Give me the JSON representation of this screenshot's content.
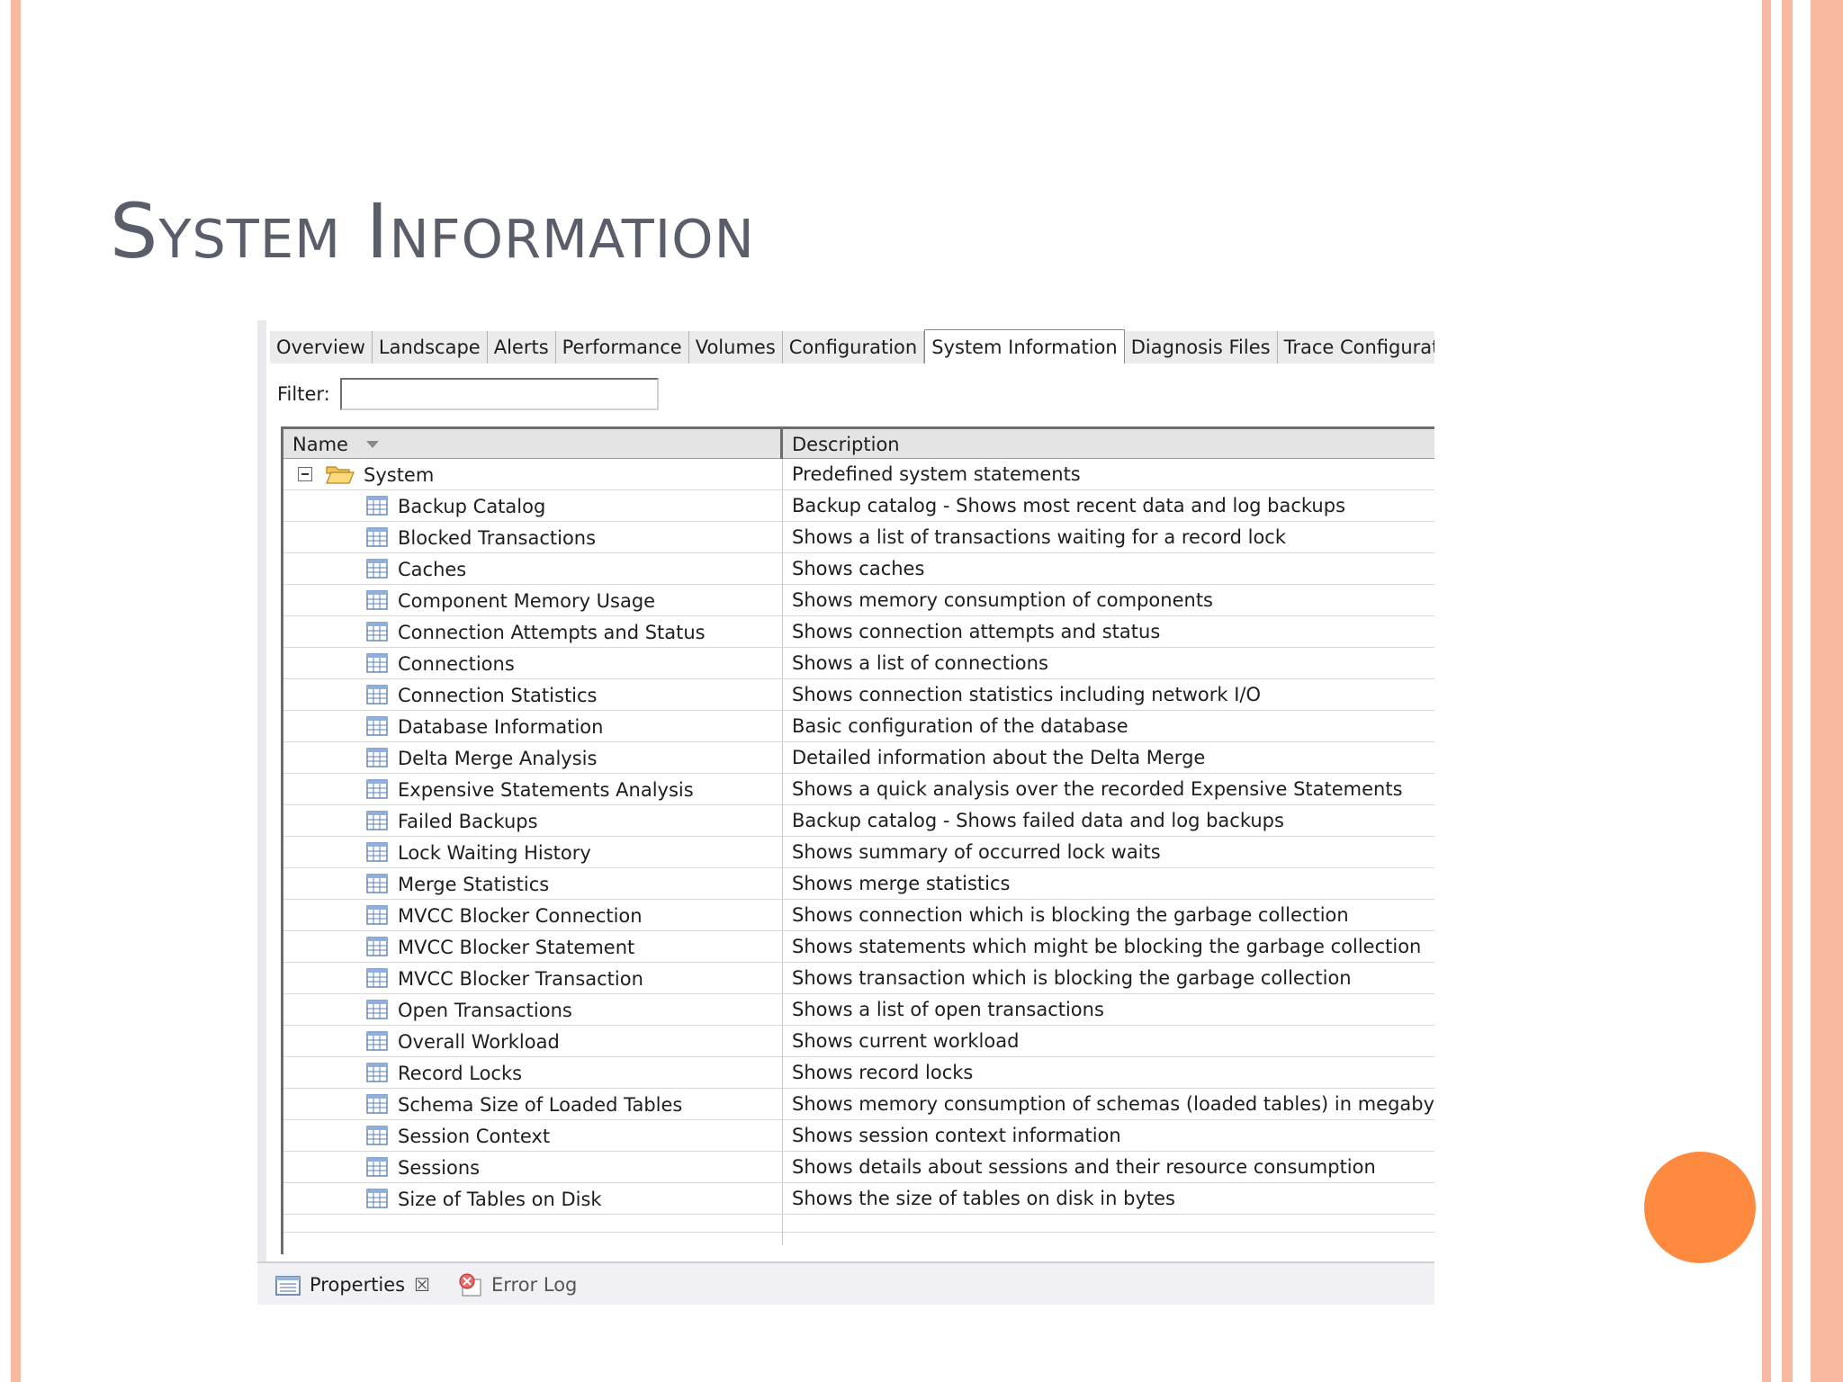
{
  "slide": {
    "title": "System Information",
    "colors": {
      "frame": "#f9b8a0",
      "dot": "#fd8a3f",
      "title": "#5a5e6b"
    }
  },
  "tabs": [
    "Overview",
    "Landscape",
    "Alerts",
    "Performance",
    "Volumes",
    "Configuration",
    "System Information",
    "Diagnosis Files",
    "Trace Configuration"
  ],
  "active_tab": "System Information",
  "filter": {
    "label": "Filter:",
    "value": ""
  },
  "table": {
    "columns": {
      "name": "Name",
      "description": "Description"
    },
    "root": {
      "name": "System",
      "description": "Predefined system statements"
    },
    "rows": [
      {
        "name": "Backup Catalog",
        "description": "Backup catalog - Shows most recent data and log backups"
      },
      {
        "name": "Blocked Transactions",
        "description": "Shows a list of transactions waiting for a record lock"
      },
      {
        "name": "Caches",
        "description": "Shows caches"
      },
      {
        "name": "Component Memory Usage",
        "description": "Shows memory consumption of components"
      },
      {
        "name": "Connection Attempts and Status",
        "description": "Shows connection attempts and status"
      },
      {
        "name": "Connections",
        "description": "Shows a list of connections"
      },
      {
        "name": "Connection Statistics",
        "description": "Shows connection statistics including network I/O"
      },
      {
        "name": "Database Information",
        "description": "Basic configuration of the database"
      },
      {
        "name": "Delta Merge Analysis",
        "description": "Detailed information about the Delta Merge"
      },
      {
        "name": "Expensive Statements Analysis",
        "description": "Shows a quick analysis over the recorded Expensive Statements"
      },
      {
        "name": "Failed Backups",
        "description": "Backup catalog - Shows failed data and log backups"
      },
      {
        "name": "Lock Waiting History",
        "description": "Shows summary of occurred lock waits"
      },
      {
        "name": "Merge Statistics",
        "description": "Shows merge statistics"
      },
      {
        "name": "MVCC Blocker Connection",
        "description": "Shows connection which is blocking the garbage collection"
      },
      {
        "name": "MVCC Blocker Statement",
        "description": "Shows statements which might be blocking the garbage collection"
      },
      {
        "name": "MVCC Blocker Transaction",
        "description": "Shows transaction which is blocking the garbage collection"
      },
      {
        "name": "Open Transactions",
        "description": "Shows a list of open transactions"
      },
      {
        "name": "Overall Workload",
        "description": "Shows current workload"
      },
      {
        "name": "Record Locks",
        "description": "Shows record locks"
      },
      {
        "name": "Schema Size of Loaded Tables",
        "description": "Shows memory consumption of schemas (loaded tables) in megabyte"
      },
      {
        "name": "Session Context",
        "description": "Shows session context information"
      },
      {
        "name": "Sessions",
        "description": "Shows details about sessions and their resource consumption"
      },
      {
        "name": "Size of Tables on Disk",
        "description": "Shows the size of tables on disk in bytes"
      }
    ]
  },
  "bottom_tabs": {
    "properties": "Properties",
    "close_glyph": "☒",
    "error_log": "Error Log"
  }
}
